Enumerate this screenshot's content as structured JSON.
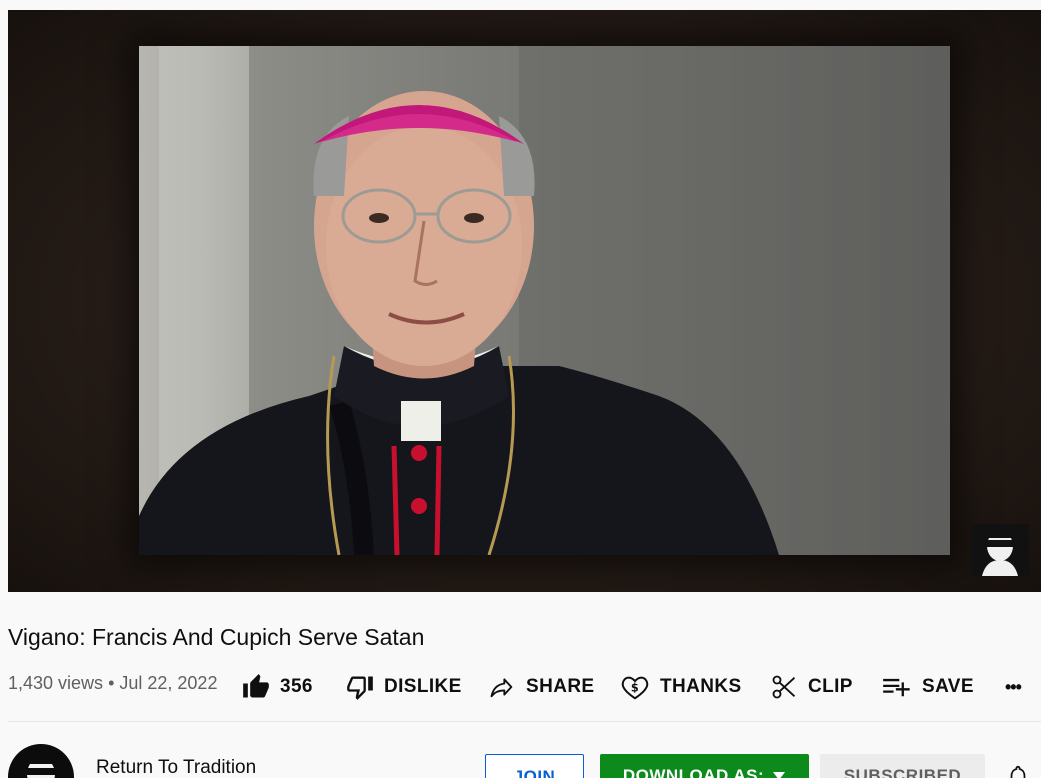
{
  "video": {
    "title": "Vigano: Francis And Cupich Serve Satan",
    "views": "1,430 views",
    "separator": "•",
    "date": "Jul 22, 2022"
  },
  "actions": {
    "like": {
      "icon": "thumbs-up-filled-icon",
      "count": "356"
    },
    "dislike": {
      "icon": "thumbs-down-icon",
      "label": "DISLIKE"
    },
    "share": {
      "icon": "share-arrow-icon",
      "label": "SHARE"
    },
    "thanks": {
      "icon": "heart-dollar-icon",
      "label": "THANKS"
    },
    "clip": {
      "icon": "scissors-icon",
      "label": "CLIP"
    },
    "save": {
      "icon": "playlist-add-icon",
      "label": "SAVE"
    },
    "more": {
      "icon": "more-horizontal-icon",
      "label": "•••"
    }
  },
  "channel": {
    "name": "Return To Tradition",
    "join_label": "JOIN",
    "download_label": "DOWNLOAD AS:",
    "download_icon": "caret-down-icon",
    "subscribed_label": "SUBSCRIBED",
    "bell_icon": "bell-icon"
  },
  "colors": {
    "join_blue": "#065fd4",
    "download_green": "#0d8a1c",
    "subscribed_gray": "#ececec",
    "cassock_red": "#c8102e",
    "zucchetto_magenta": "#c2187a"
  }
}
